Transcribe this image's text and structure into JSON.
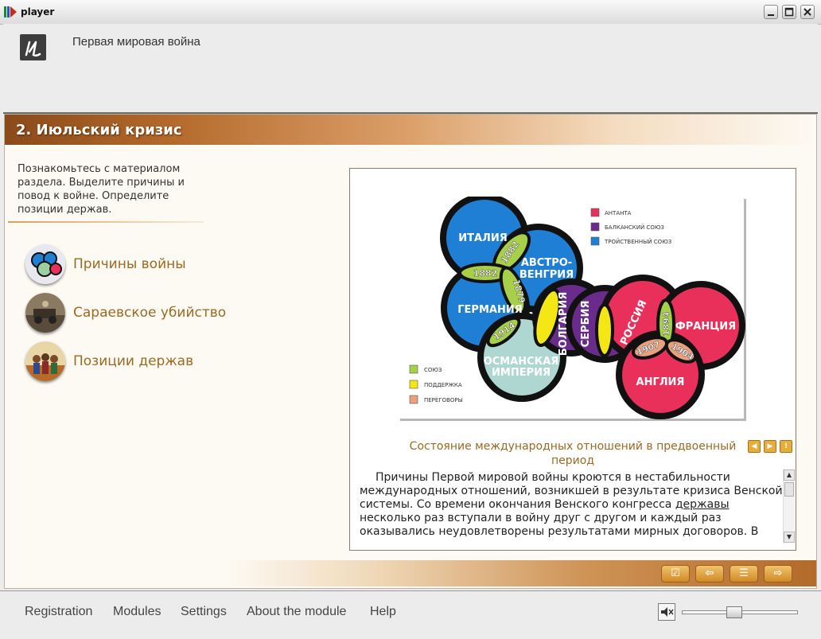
{
  "window": {
    "title": "player"
  },
  "header": {
    "course_title": "Первая мировая война"
  },
  "section": {
    "title": "2. Июльский кризис"
  },
  "instruction": "Познакомьтесь с материалом раздела. Выделите причины и повод к войне. Определите позиции держав.",
  "nav_items": [
    {
      "label": "Причины войны",
      "icon": "globe-alliances-icon"
    },
    {
      "label": "Сараевское убийство",
      "icon": "car-photo-icon"
    },
    {
      "label": "Позиции держав",
      "icon": "leaders-photo-icon"
    }
  ],
  "diagram": {
    "circles": {
      "italy": "ИТАЛИЯ",
      "austria_line1": "АВСТРО-",
      "austria_line2": "ВЕНГРИЯ",
      "germany": "ГЕРМАНИЯ",
      "ottoman_line1": "ОСМАНСКАЯ",
      "ottoman_line2": "ИМПЕРИЯ",
      "bulgaria": "БОЛГАРИЯ",
      "serbia": "СЕРБИЯ",
      "russia": "РОССИЯ",
      "france": "ФРАНЦИЯ",
      "england": "АНГЛИЯ"
    },
    "years": {
      "y1882a": "1882",
      "y1882b": "1882",
      "y1879": "1879",
      "y1914": "1914",
      "y1894": "1894",
      "y1907": "1907",
      "y1904": "1904"
    },
    "legend_top": [
      {
        "label": "АНТАНТА",
        "color": "#e8305a"
      },
      {
        "label": "БАЛКАНСКИЙ СОЮЗ",
        "color": "#6a2c8a"
      },
      {
        "label": "ТРОЙСТВЕННЫЙ СОЮЗ",
        "color": "#1e7fd4"
      }
    ],
    "legend_bottom": [
      {
        "label": "СОЮЗ",
        "color": "#a8cf4a"
      },
      {
        "label": "ПОДДЕРЖКА",
        "color": "#f5e616"
      },
      {
        "label": "ПЕРЕГОВОРЫ",
        "color": "#e9a07c"
      }
    ]
  },
  "caption": "Состояние международных отношений в предвоенный период",
  "text": {
    "part1": "Причины Первой мировой войны кроются в нестабильности международных отношений, возникшей в результате кризиса Венской системы. Со времени окончания Венского конгресса ",
    "link": "державы",
    "part2": " несколько раз вступали в войну друг с другом и каждый раз оказывались неудовлетворены результатами мирных договоров. В"
  },
  "bottom_menu": [
    "Registration",
    "Modules",
    "Settings",
    "About the module",
    "Help"
  ],
  "volume": {
    "level": 0.45
  }
}
